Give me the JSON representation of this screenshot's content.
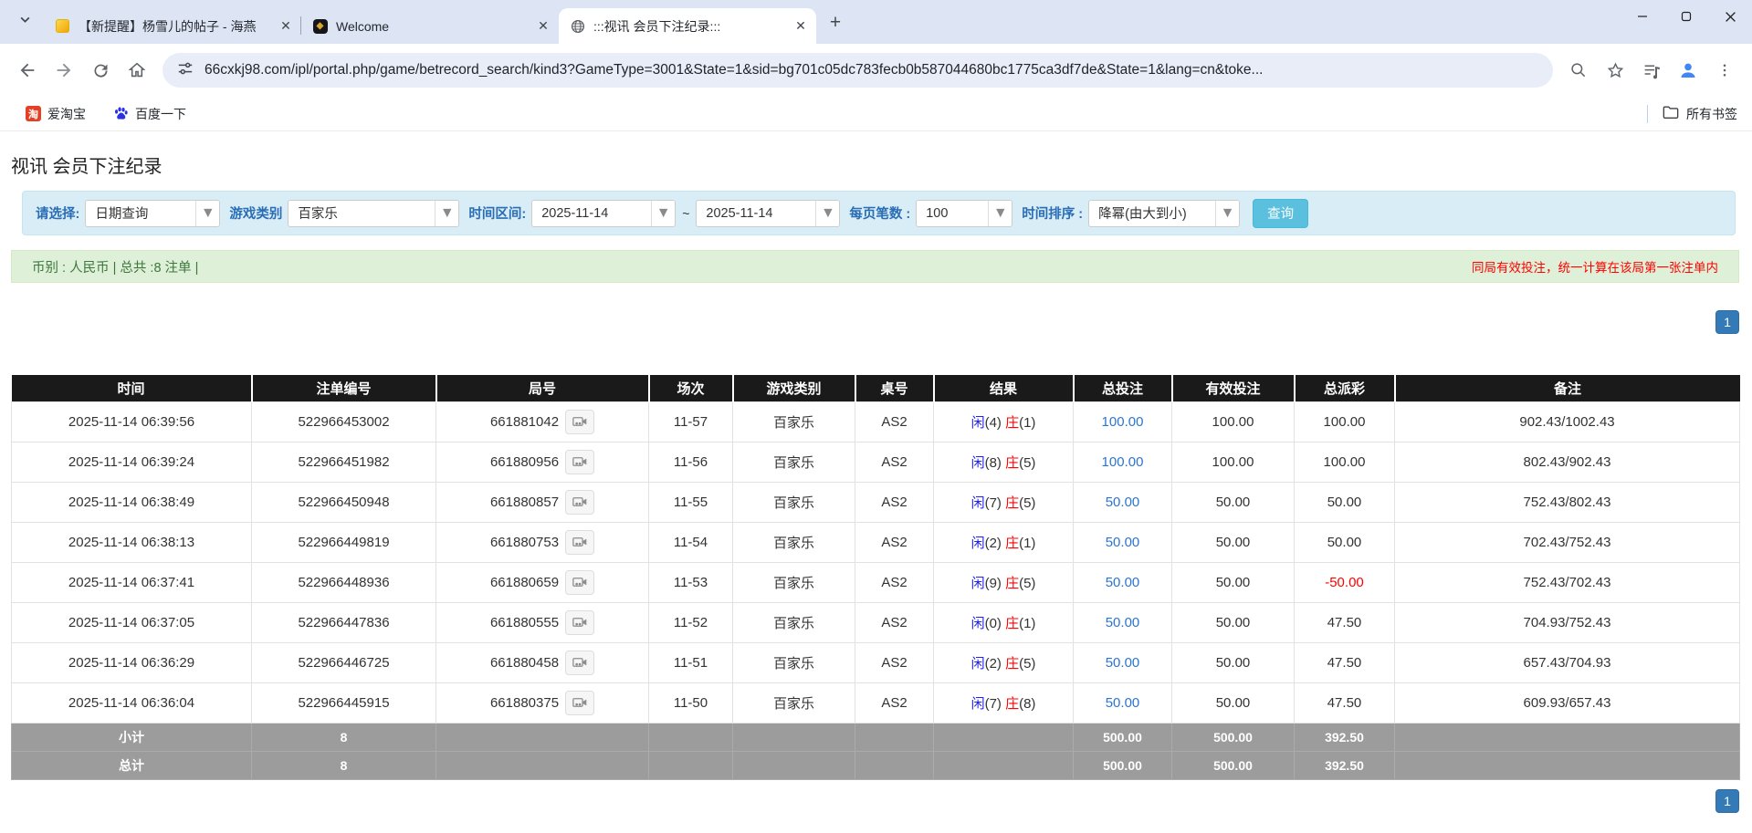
{
  "browser": {
    "tabs": [
      {
        "title": "【新提醒】杨雪儿的帖子 - 海燕",
        "active": false
      },
      {
        "title": "Welcome",
        "active": false
      },
      {
        "title": ":::视讯 会员下注纪录:::",
        "active": true
      }
    ],
    "url": "66cxkj98.com/ipl/portal.php/game/betrecord_search/kind3?GameType=3001&State=1&sid=bg701c05dc783fecb0b587044680bc1775ca3df7de&State=1&lang=cn&toke...",
    "bookmarks": [
      {
        "label": "爱淘宝"
      },
      {
        "label": "百度一下"
      }
    ],
    "all_bookmarks_label": "所有书签"
  },
  "page": {
    "title": "视讯 会员下注纪录",
    "filters": {
      "select_label": "请选择:",
      "select_value": "日期查询",
      "game_type_label": "游戏类别",
      "game_type_value": "百家乐",
      "date_range_label": "时间区间:",
      "date_from": "2025-11-14",
      "tilde": "~",
      "date_to": "2025-11-14",
      "page_size_label": "每页笔数 :",
      "page_size_value": "100",
      "sort_label": "时间排序 :",
      "sort_value": "降幂(由大到小)",
      "search_button": "查询"
    },
    "summary": {
      "left": "币别 : 人民币 | 总共 :8 注单 |",
      "right_notice": "同局有效投注，统一计算在该局第一张注单内"
    },
    "pagination": {
      "current": "1"
    },
    "colors": {
      "accent_blue": "#337ab7",
      "search_button_cyan": "#5bc0de",
      "filter_bg": "#d9edf7",
      "summary_bg": "#dff0d8",
      "player_blue": "#2222ee",
      "banker_red": "#ff0000",
      "negative_red": "#ff0000",
      "header_bg": "#1a1a1a",
      "total_row_bg": "#9c9c9c"
    },
    "table": {
      "headers": [
        "时间",
        "注单编号",
        "局号",
        "场次",
        "游戏类别",
        "桌号",
        "结果",
        "总投注",
        "有效投注",
        "总派彩",
        "备注"
      ],
      "rows": [
        {
          "time": "2025-11-14 06:39:56",
          "bet_id": "522966453002",
          "round_id": "661881042",
          "session": "11-57",
          "game": "百家乐",
          "table": "AS2",
          "result": {
            "player": "闲",
            "player_n": "(4)",
            "banker": "庄",
            "banker_n": "(1)"
          },
          "total_bet": "100.00",
          "valid_bet": "100.00",
          "payout": "100.00",
          "remark": "902.43/1002.43"
        },
        {
          "time": "2025-11-14 06:39:24",
          "bet_id": "522966451982",
          "round_id": "661880956",
          "session": "11-56",
          "game": "百家乐",
          "table": "AS2",
          "result": {
            "player": "闲",
            "player_n": "(8)",
            "banker": "庄",
            "banker_n": "(5)"
          },
          "total_bet": "100.00",
          "valid_bet": "100.00",
          "payout": "100.00",
          "remark": "802.43/902.43"
        },
        {
          "time": "2025-11-14 06:38:49",
          "bet_id": "522966450948",
          "round_id": "661880857",
          "session": "11-55",
          "game": "百家乐",
          "table": "AS2",
          "result": {
            "player": "闲",
            "player_n": "(7)",
            "banker": "庄",
            "banker_n": "(5)"
          },
          "total_bet": "50.00",
          "valid_bet": "50.00",
          "payout": "50.00",
          "remark": "752.43/802.43"
        },
        {
          "time": "2025-11-14 06:38:13",
          "bet_id": "522966449819",
          "round_id": "661880753",
          "session": "11-54",
          "game": "百家乐",
          "table": "AS2",
          "result": {
            "player": "闲",
            "player_n": "(2)",
            "banker": "庄",
            "banker_n": "(1)"
          },
          "total_bet": "50.00",
          "valid_bet": "50.00",
          "payout": "50.00",
          "remark": "702.43/752.43"
        },
        {
          "time": "2025-11-14 06:37:41",
          "bet_id": "522966448936",
          "round_id": "661880659",
          "session": "11-53",
          "game": "百家乐",
          "table": "AS2",
          "result": {
            "player": "闲",
            "player_n": "(9)",
            "banker": "庄",
            "banker_n": "(5)"
          },
          "total_bet": "50.00",
          "valid_bet": "50.00",
          "payout": "-50.00",
          "remark": "752.43/702.43"
        },
        {
          "time": "2025-11-14 06:37:05",
          "bet_id": "522966447836",
          "round_id": "661880555",
          "session": "11-52",
          "game": "百家乐",
          "table": "AS2",
          "result": {
            "player": "闲",
            "player_n": "(0)",
            "banker": "庄",
            "banker_n": "(1)"
          },
          "total_bet": "50.00",
          "valid_bet": "50.00",
          "payout": "47.50",
          "remark": "704.93/752.43"
        },
        {
          "time": "2025-11-14 06:36:29",
          "bet_id": "522966446725",
          "round_id": "661880458",
          "session": "11-51",
          "game": "百家乐",
          "table": "AS2",
          "result": {
            "player": "闲",
            "player_n": "(2)",
            "banker": "庄",
            "banker_n": "(5)"
          },
          "total_bet": "50.00",
          "valid_bet": "50.00",
          "payout": "47.50",
          "remark": "657.43/704.93"
        },
        {
          "time": "2025-11-14 06:36:04",
          "bet_id": "522966445915",
          "round_id": "661880375",
          "session": "11-50",
          "game": "百家乐",
          "table": "AS2",
          "result": {
            "player": "闲",
            "player_n": "(7)",
            "banker": "庄",
            "banker_n": "(8)"
          },
          "total_bet": "50.00",
          "valid_bet": "50.00",
          "payout": "47.50",
          "remark": "609.93/657.43"
        }
      ],
      "subtotal": {
        "label": "小计",
        "count": "8",
        "total_bet": "500.00",
        "valid_bet": "500.00",
        "payout": "392.50"
      },
      "total": {
        "label": "总计",
        "count": "8",
        "total_bet": "500.00",
        "valid_bet": "500.00",
        "payout": "392.50"
      }
    }
  }
}
